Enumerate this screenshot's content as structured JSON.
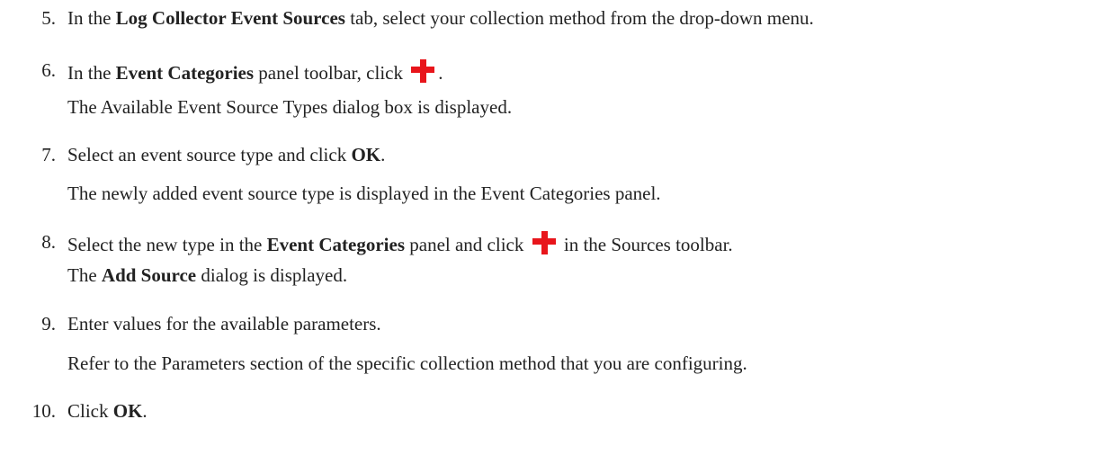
{
  "steps": [
    {
      "number": "5.",
      "parts": [
        "In the ",
        "Log Collector Event Sources",
        " tab, select your collection method from the drop-down menu."
      ]
    },
    {
      "number": "6.",
      "parts": [
        "In the ",
        "Event Categories",
        " panel toolbar, click ",
        "."
      ],
      "icon": "add-plus-icon",
      "note": "The Available Event Source Types dialog box is displayed."
    },
    {
      "number": "7.",
      "parts": [
        "Select an event source type and click ",
        "OK",
        "."
      ],
      "note": "The newly added event source type is displayed in the Event Categories panel."
    },
    {
      "number": "8.",
      "parts": [
        "Select the new type in the ",
        "Event Categories",
        " panel and click ",
        " in the Sources toolbar."
      ],
      "icon": "add-plus-icon",
      "note_parts": [
        "The ",
        "Add Source",
        " dialog is displayed."
      ]
    },
    {
      "number": "9.",
      "parts": [
        "Enter values for the available parameters."
      ],
      "note": "Refer to the Parameters section of the specific collection method that you are configuring."
    },
    {
      "number": "10.",
      "parts": [
        "Click ",
        "OK",
        "."
      ]
    }
  ],
  "colors": {
    "text": "#222222",
    "plus_icon": "#e8151b"
  }
}
